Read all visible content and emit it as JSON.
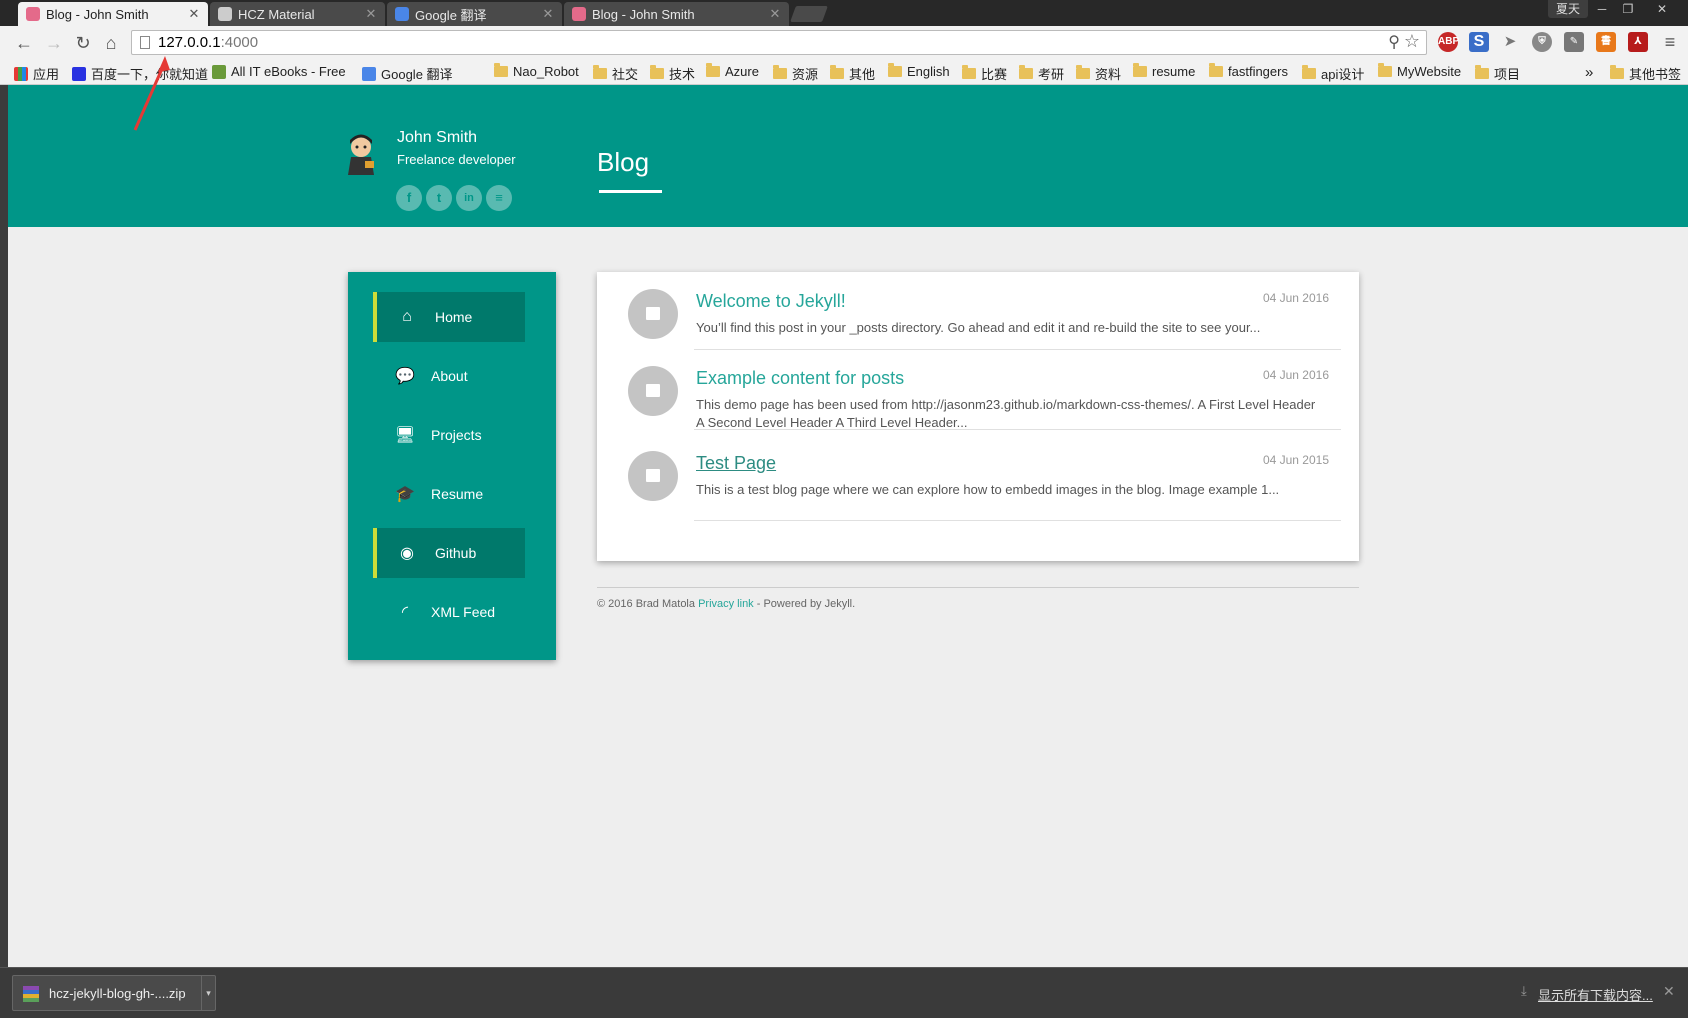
{
  "browser": {
    "tabs": [
      {
        "title": "Blog - John Smith",
        "active": true
      },
      {
        "title": "HCZ Material",
        "active": false
      },
      {
        "title": "Google 翻译",
        "active": false
      },
      {
        "title": "Blog - John Smith",
        "active": false
      }
    ],
    "profile_name": "夏天",
    "url_host": "127.0.0.1",
    "url_port": ":4000",
    "bookmarks": {
      "apps": "应用",
      "baidu": "百度一下，你就知道",
      "itebooks": "All IT eBooks - Free",
      "google_translate": "Google 翻译",
      "folders": [
        "Nao_Robot",
        "社交",
        "技术",
        "Azure",
        "资源",
        "其他",
        "English",
        "比赛",
        "考研",
        "资料",
        "resume",
        "fastfingers",
        "api设计",
        "MyWebsite",
        "项目"
      ],
      "overflow": "»",
      "other": "其他书签"
    }
  },
  "site": {
    "name": "John Smith",
    "tagline": "Freelance developer",
    "page_title": "Blog",
    "social": [
      "f",
      "t",
      "in",
      "≡"
    ]
  },
  "nav": [
    {
      "label": "Home",
      "icon": "home-icon",
      "glyph": "⌂",
      "active": true
    },
    {
      "label": "About",
      "icon": "comments-icon",
      "glyph": "💬",
      "active": false
    },
    {
      "label": "Projects",
      "icon": "desktop-icon",
      "glyph": "🖥",
      "active": false
    },
    {
      "label": "Resume",
      "icon": "graduation-cap-icon",
      "glyph": "🎓",
      "active": false
    },
    {
      "label": "Github",
      "icon": "github-icon",
      "glyph": "◉",
      "active": true
    },
    {
      "label": "XML Feed",
      "icon": "rss-icon",
      "glyph": "◜",
      "active": false
    }
  ],
  "posts": [
    {
      "title": "Welcome to Jekyll!",
      "date": "04 Jun 2016",
      "excerpt": "You’ll find this post in your _posts directory. Go ahead and edit it and re-build the site to see your..."
    },
    {
      "title": "Example content for posts",
      "date": "04 Jun 2016",
      "excerpt": "This demo page has been used from http://jasonm23.github.io/markdown-css-themes/. A First Level Header A Second Level Header A Third Level Header..."
    },
    {
      "title": "Test Page",
      "date": "04 Jun 2015",
      "excerpt": "This is a test blog page where we can explore how to embedd images in the blog. Image example 1..."
    }
  ],
  "footer": {
    "copyright": "© 2016 Brad Matola",
    "privacy": "Privacy link",
    "powered": "- Powered by Jekyll."
  },
  "downloads": {
    "file": "hcz-jekyll-blog-gh-....zip",
    "show_all": "显示所有下载内容..."
  },
  "colors": {
    "primary": "#009688",
    "primary_dark": "#00796b",
    "accent": "#cddc39",
    "link": "#26a69a"
  }
}
